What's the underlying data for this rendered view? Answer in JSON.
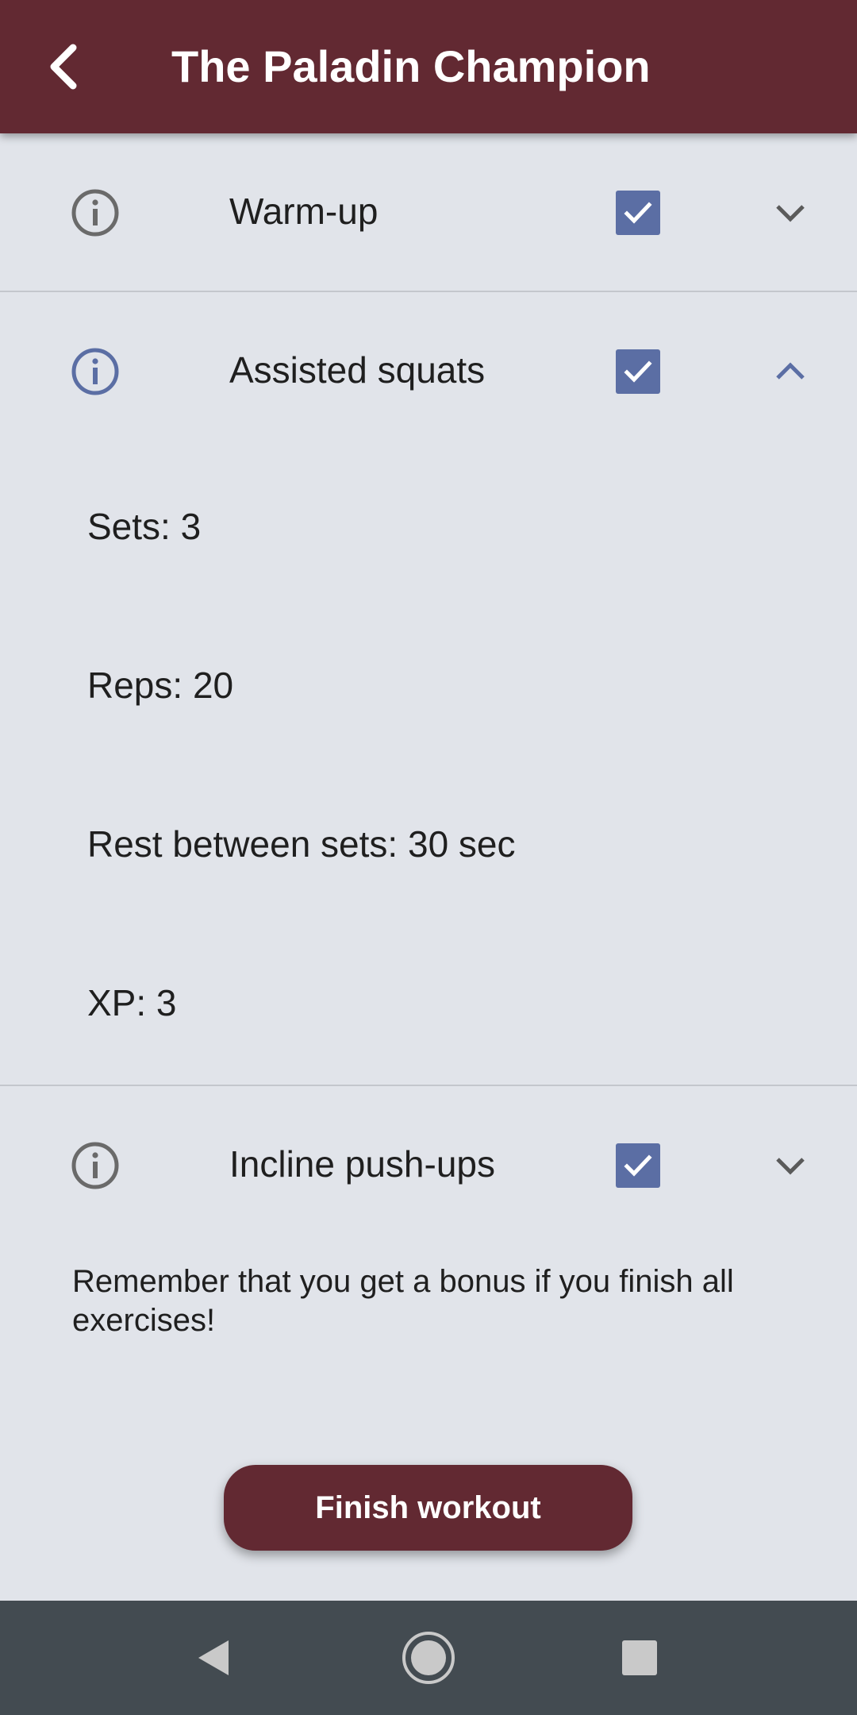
{
  "app_bar": {
    "title": "The Paladin Champion",
    "back_icon": "arrow-back-icon"
  },
  "colors": {
    "primary": "#622932",
    "accent": "#5b6ea4",
    "background": "#e1e4ea",
    "nav_bar": "#434b51"
  },
  "exercises": [
    {
      "label": "Warm-up",
      "checked": true,
      "expanded": false,
      "info_icon": "info-icon",
      "chevron_icon": "chevron-down-icon"
    },
    {
      "label": "Assisted squats",
      "checked": true,
      "expanded": true,
      "info_icon": "info-icon",
      "chevron_icon": "chevron-up-icon",
      "details": {
        "sets": "Sets: 3",
        "reps": "Reps: 20",
        "rest": "Rest between sets: 30 sec",
        "xp": "XP: 3"
      }
    },
    {
      "label": "Incline push-ups",
      "checked": true,
      "expanded": false,
      "info_icon": "info-icon",
      "chevron_icon": "chevron-down-icon"
    }
  ],
  "bonus_message": "Remember that you get a bonus if you finish all exercises!",
  "finish_button": {
    "label": "Finish workout"
  },
  "system_nav": {
    "back_icon": "nav-back-icon",
    "home_icon": "nav-home-icon",
    "recents_icon": "nav-recents-icon"
  }
}
